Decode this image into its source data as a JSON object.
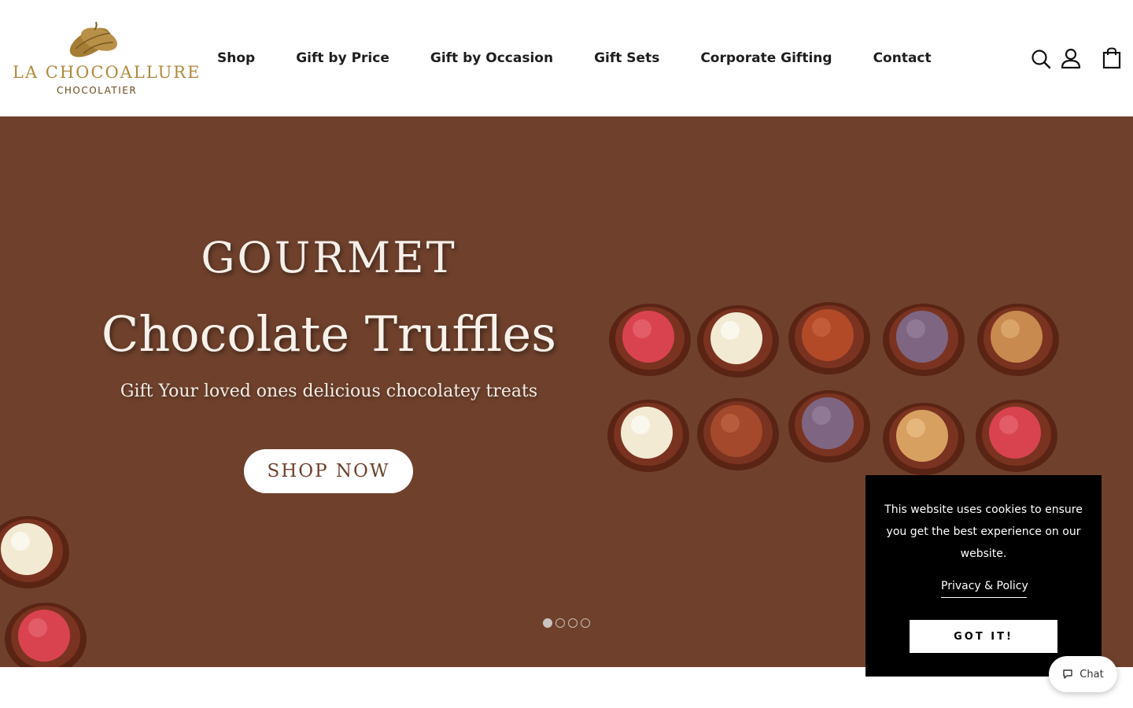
{
  "header": {
    "logo": {
      "brand": "LA CHOCOALLURE",
      "sub": "CHOCOLATIER"
    },
    "nav": [
      {
        "label": "Shop"
      },
      {
        "label": "Gift by Price"
      },
      {
        "label": "Gift by Occasion"
      },
      {
        "label": "Gift Sets"
      },
      {
        "label": "Corporate Gifting"
      },
      {
        "label": "Contact"
      }
    ],
    "icons": [
      "search-icon",
      "account-icon",
      "cart-icon"
    ]
  },
  "hero": {
    "title1": "GOURMET",
    "title2": "Chocolate Truffles",
    "subtitle": "Gift Your loved ones delicious chocolatey treats",
    "button": "SHOP NOW",
    "slides": 4,
    "active_slide": 1,
    "background": "#6f412c"
  },
  "cookie": {
    "text": "This website uses cookies to ensure you get the best experience on our website.",
    "link": "Privacy & Policy",
    "button": "GOT IT!"
  },
  "chat": {
    "label": "Chat"
  },
  "colors": {
    "brand_gold": "#b08a3e",
    "hero_brown": "#6f412c",
    "cookie_bg": "#000000"
  }
}
